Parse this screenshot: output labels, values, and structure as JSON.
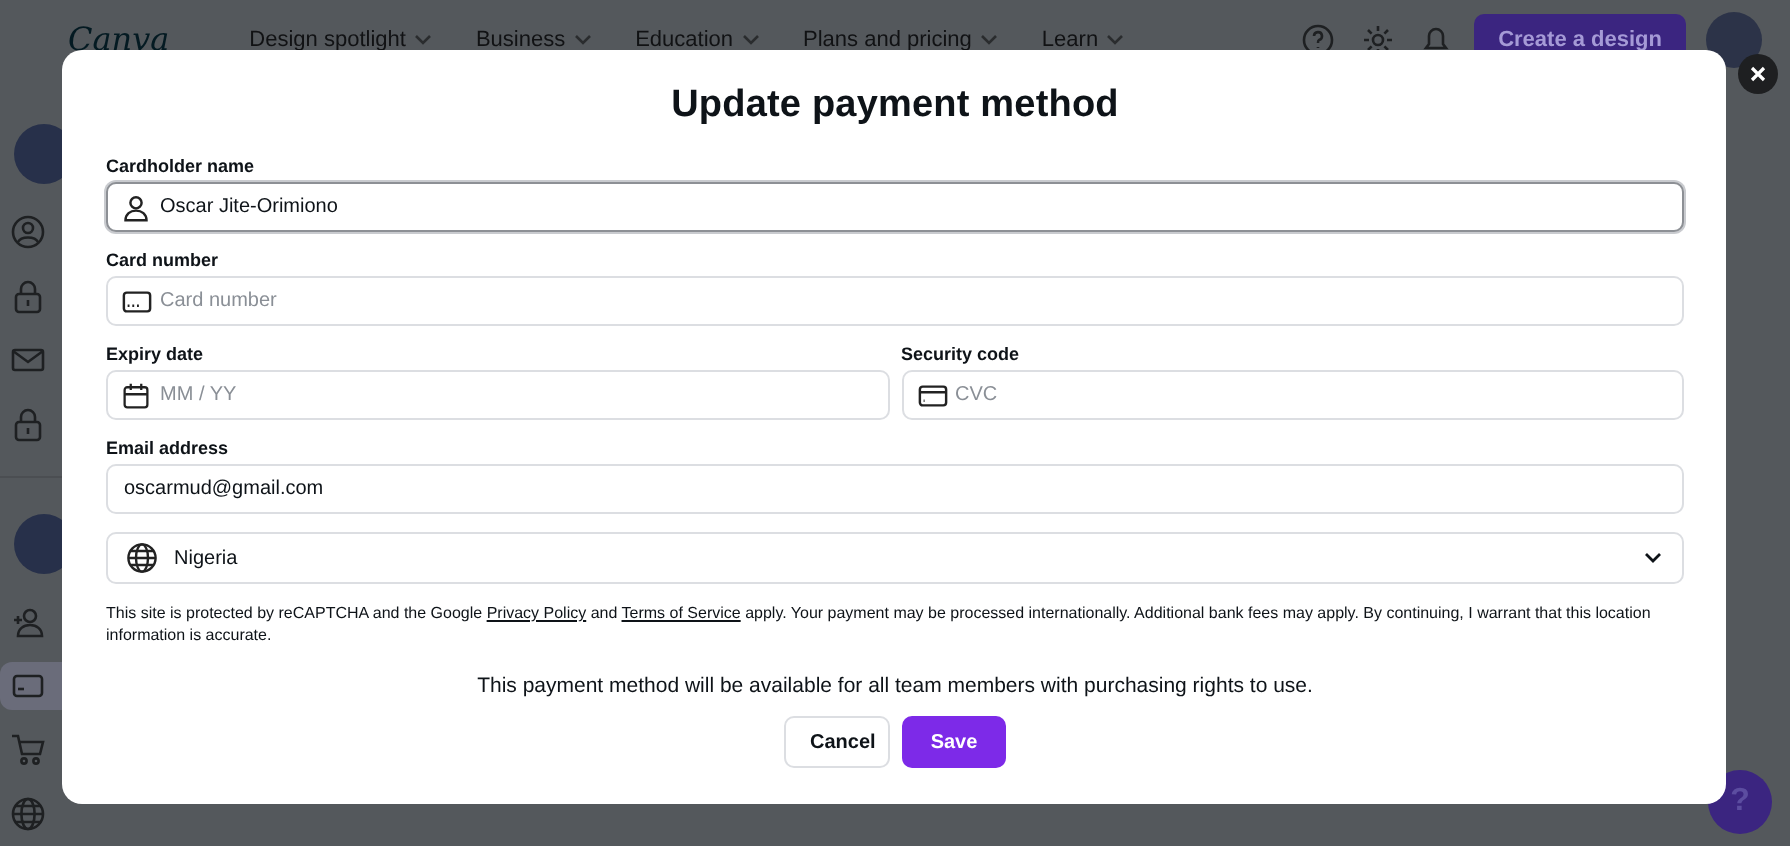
{
  "header": {
    "logo": "Canva",
    "nav": [
      {
        "label": "Design spotlight"
      },
      {
        "label": "Business"
      },
      {
        "label": "Education"
      },
      {
        "label": "Plans and pricing"
      },
      {
        "label": "Learn"
      }
    ],
    "create_button": "Create a design"
  },
  "sidebar": {
    "items": [
      {
        "selected": false
      },
      {
        "selected": false
      },
      {
        "selected": false
      },
      {
        "selected": false
      },
      {
        "selected": false
      },
      {
        "selected": true
      },
      {
        "selected": false
      },
      {
        "selected": false
      }
    ]
  },
  "modal": {
    "title": "Update payment method",
    "rows": [
      {
        "fields": [
          {
            "kind": "text",
            "label": "Cardholder name",
            "value": "Oscar Jite-Orimiono",
            "focused": true
          }
        ]
      },
      {
        "fields": [
          {
            "kind": "text",
            "label": "Card number",
            "placeholder": "Card number",
            "focused": false
          }
        ]
      },
      {
        "fields": [
          {
            "kind": "text",
            "label": "Expiry date",
            "placeholder": "MM / YY",
            "focused": false
          },
          {
            "kind": "text",
            "label": "Security code",
            "placeholder": "CVC",
            "focused": false
          }
        ]
      },
      {
        "fields": [
          {
            "kind": "text",
            "label": "Email address",
            "value": "oscarmud@gmail.com",
            "focused": false
          }
        ]
      },
      {
        "fields": [
          {
            "kind": "select",
            "value": "Nigeria"
          }
        ]
      }
    ],
    "legal": [
      {
        "kind": "text",
        "text": "This site is protected by reCAPTCHA and the Google "
      },
      {
        "kind": "link",
        "text": "Privacy Policy"
      },
      {
        "kind": "text",
        "text": " and "
      },
      {
        "kind": "link",
        "text": "Terms of Service"
      },
      {
        "kind": "text",
        "text": " apply. Your payment may be processed internationally. Additional bank fees may apply. By continuing, I warrant that this location information is accurate."
      }
    ],
    "note": "This payment method will be available for all team members with purchasing rights to use.",
    "buttons": [
      {
        "kind": "secondary",
        "label": "Cancel"
      },
      {
        "kind": "primary",
        "label": "Save"
      }
    ]
  },
  "help_button": "?"
}
